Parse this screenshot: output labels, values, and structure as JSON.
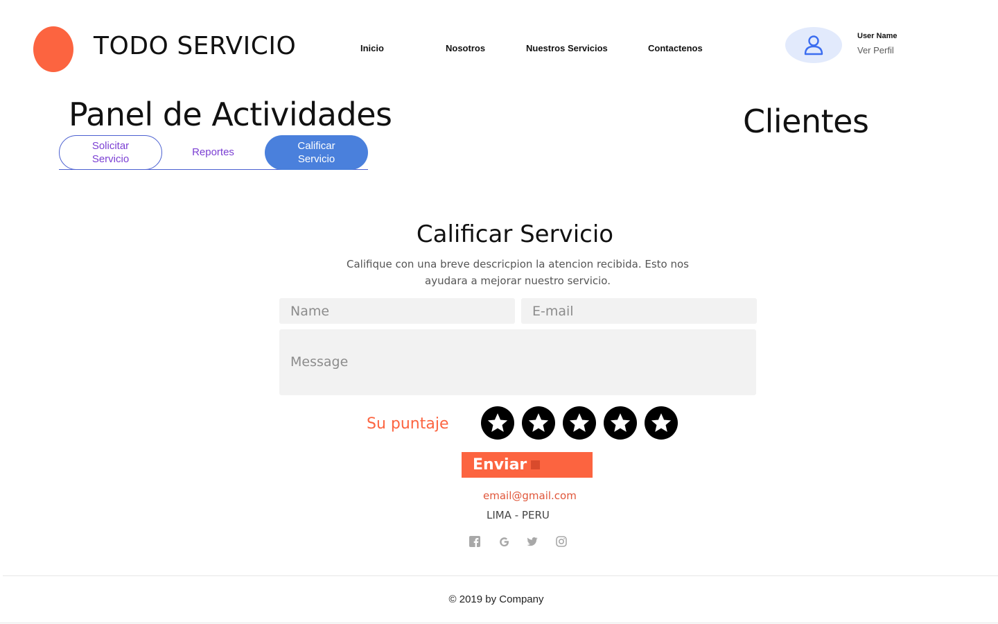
{
  "header": {
    "brand": "TODO SERVICIO",
    "nav": [
      "Inicio",
      "Nosotros",
      "Nuestros Servicios",
      "Contactenos"
    ],
    "user": {
      "name": "User Name",
      "profile_link": "Ver Perfil",
      "icon": "user-icon"
    }
  },
  "panel": {
    "title": "Panel de Actividades",
    "tabs": [
      {
        "label": "Solicitar Servicio",
        "state": "outlined"
      },
      {
        "label": "Reportes",
        "state": "plain"
      },
      {
        "label": "Calificar Servicio",
        "state": "active"
      }
    ]
  },
  "sidebar": {
    "title": "Clientes"
  },
  "form": {
    "title": "Calificar Servicio",
    "description": "Califique con una breve descricpion la atencion recibida. Esto nos ayudara a mejorar nuestro servicio.",
    "name_placeholder": "Name",
    "email_placeholder": "E-mail",
    "message_placeholder": "Message",
    "score_label": "Su puntaje",
    "stars_total": 5,
    "submit_label": "Enviar"
  },
  "contact": {
    "email": "email@gmail.com",
    "location": "LIMA - PERU",
    "social_icons": [
      "facebook-icon",
      "google-icon",
      "twitter-icon",
      "instagram-icon"
    ]
  },
  "footer": {
    "copyright": "© 2019 by Company"
  },
  "colors": {
    "brand_orange": "#fc6440",
    "accent_blue": "#4a80dc",
    "tab_text_purple": "#7b3fd3",
    "avatar_bg": "#e2eafc",
    "input_bg": "#f2f2f2"
  }
}
